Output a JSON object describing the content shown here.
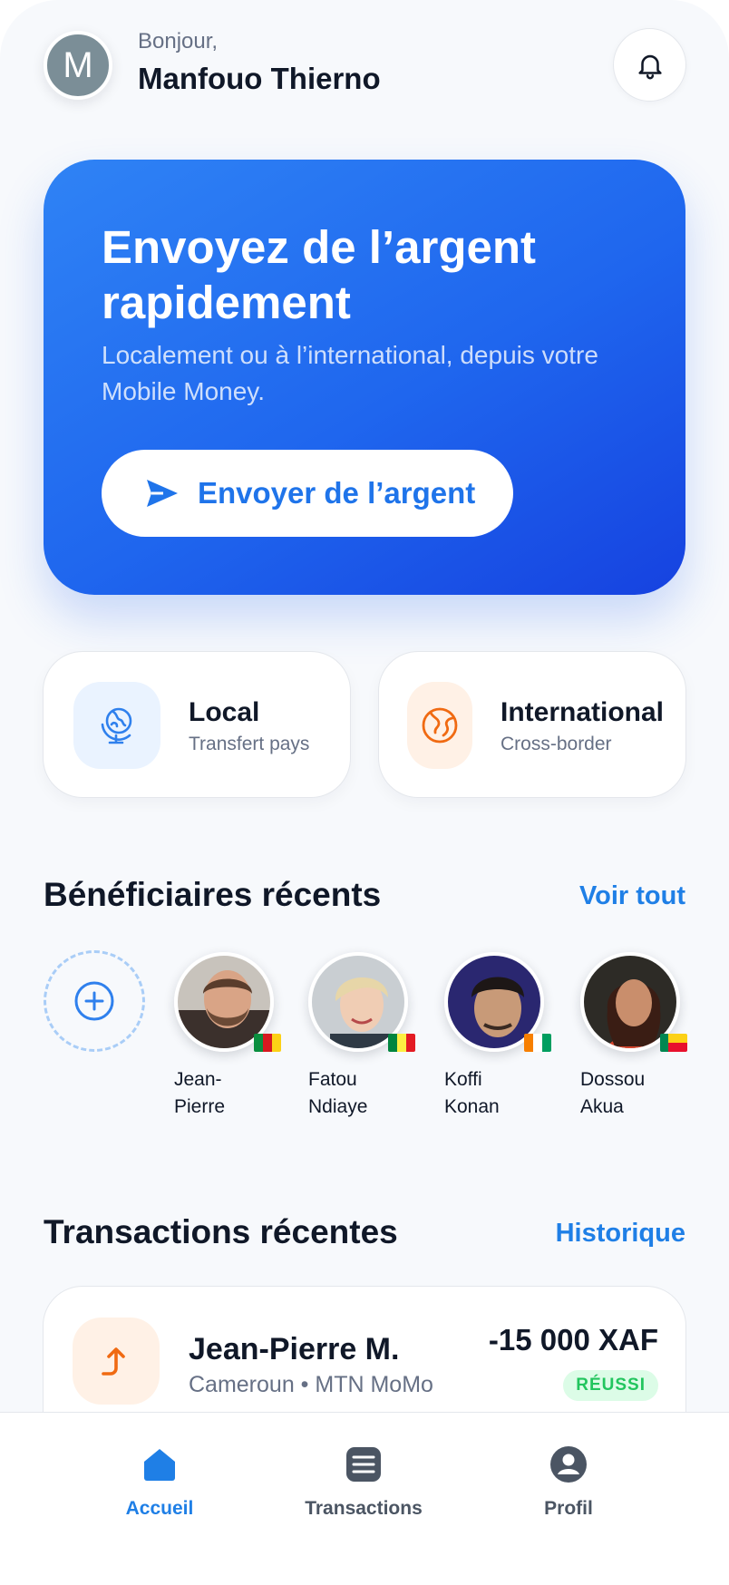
{
  "user": {
    "avatar_initial": "M",
    "greeting": "Bonjour,",
    "name": "Manfouo Thierno"
  },
  "hero": {
    "title": "Envoyez de l’argent rapidement",
    "subtitle": "Localement ou à l’international, depuis votre Mobile Money.",
    "button_label": "Envoyer de l’argent"
  },
  "transfer_types": [
    {
      "title": "Local",
      "subtitle": "Transfert pays",
      "icon": "globe-stand-icon"
    },
    {
      "title": "International",
      "subtitle": "Cross-border",
      "icon": "globe-icon"
    }
  ],
  "beneficiaries": {
    "title": "Bénéficiaires récents",
    "link": "Voir tout",
    "items": [
      {
        "first": "Jean-",
        "last": "Pierre",
        "flag": "cameroon-flag"
      },
      {
        "first": "Fatou",
        "last": "Ndiaye",
        "flag": "senegal-flag"
      },
      {
        "first": "Koffi",
        "last": "Konan",
        "flag": "cote-divoire-flag"
      },
      {
        "first": "Dossou",
        "last": "Akua",
        "flag": "benin-flag"
      }
    ]
  },
  "transactions": {
    "title": "Transactions récentes",
    "link": "Historique",
    "items": [
      {
        "name": "Jean-Pierre M.",
        "detail": "Cameroun • MTN MoMo",
        "amount": "-15 000 XAF",
        "status": "RÉUSSI"
      }
    ]
  },
  "nav": [
    {
      "label": "Accueil",
      "icon": "home-icon",
      "active": true
    },
    {
      "label": "Transactions",
      "icon": "list-icon",
      "active": false
    },
    {
      "label": "Profil",
      "icon": "profile-icon",
      "active": false
    }
  ],
  "colors": {
    "accent": "#1f7fe6",
    "hero_start": "#2f83f5",
    "hero_end": "#1642e0",
    "orange": "#f06a12",
    "success": "#22c55e"
  }
}
